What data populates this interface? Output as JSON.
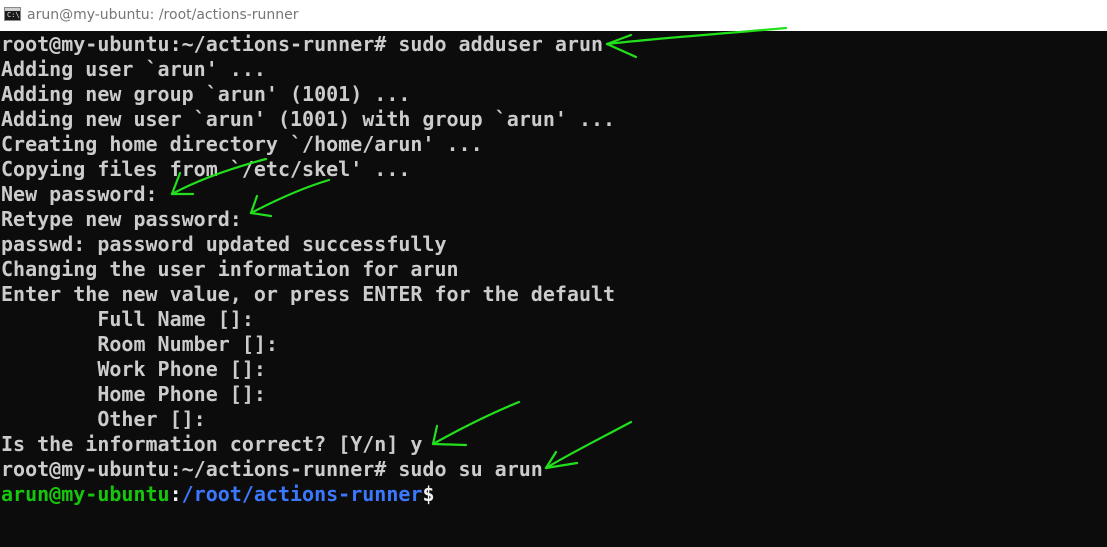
{
  "window": {
    "title": "arun@my-ubuntu: /root/actions-runner",
    "icon": "console-app-icon",
    "icon_glyph": "C:\\."
  },
  "terminal": {
    "lines": [
      "root@my-ubuntu:~/actions-runner# sudo adduser arun",
      "Adding user `arun' ...",
      "Adding new group `arun' (1001) ...",
      "Adding new user `arun' (1001) with group `arun' ...",
      "Creating home directory `/home/arun' ...",
      "Copying files from `/etc/skel' ...",
      "New password:",
      "Retype new password:",
      "passwd: password updated successfully",
      "Changing the user information for arun",
      "Enter the new value, or press ENTER for the default",
      "        Full Name []:",
      "        Room Number []:",
      "        Work Phone []:",
      "        Home Phone []:",
      "        Other []:",
      "Is the information correct? [Y/n] y",
      "root@my-ubuntu:~/actions-runner# sudo su arun"
    ],
    "prompt": {
      "user_host": "arun@my-ubuntu",
      "separator": ":",
      "path": "/root/actions-runner",
      "symbol": "$"
    }
  },
  "colors": {
    "background": "#0c0c0c",
    "text": "#cccccc",
    "prompt_user": "#16c60c",
    "prompt_path": "#3b78ff",
    "annotation_arrow": "#22e01c"
  },
  "annotations": {
    "arrows": [
      "annotation-arrow-adduser",
      "annotation-arrow-new-password",
      "annotation-arrow-retype-password",
      "annotation-arrow-confirm",
      "annotation-arrow-su"
    ]
  }
}
